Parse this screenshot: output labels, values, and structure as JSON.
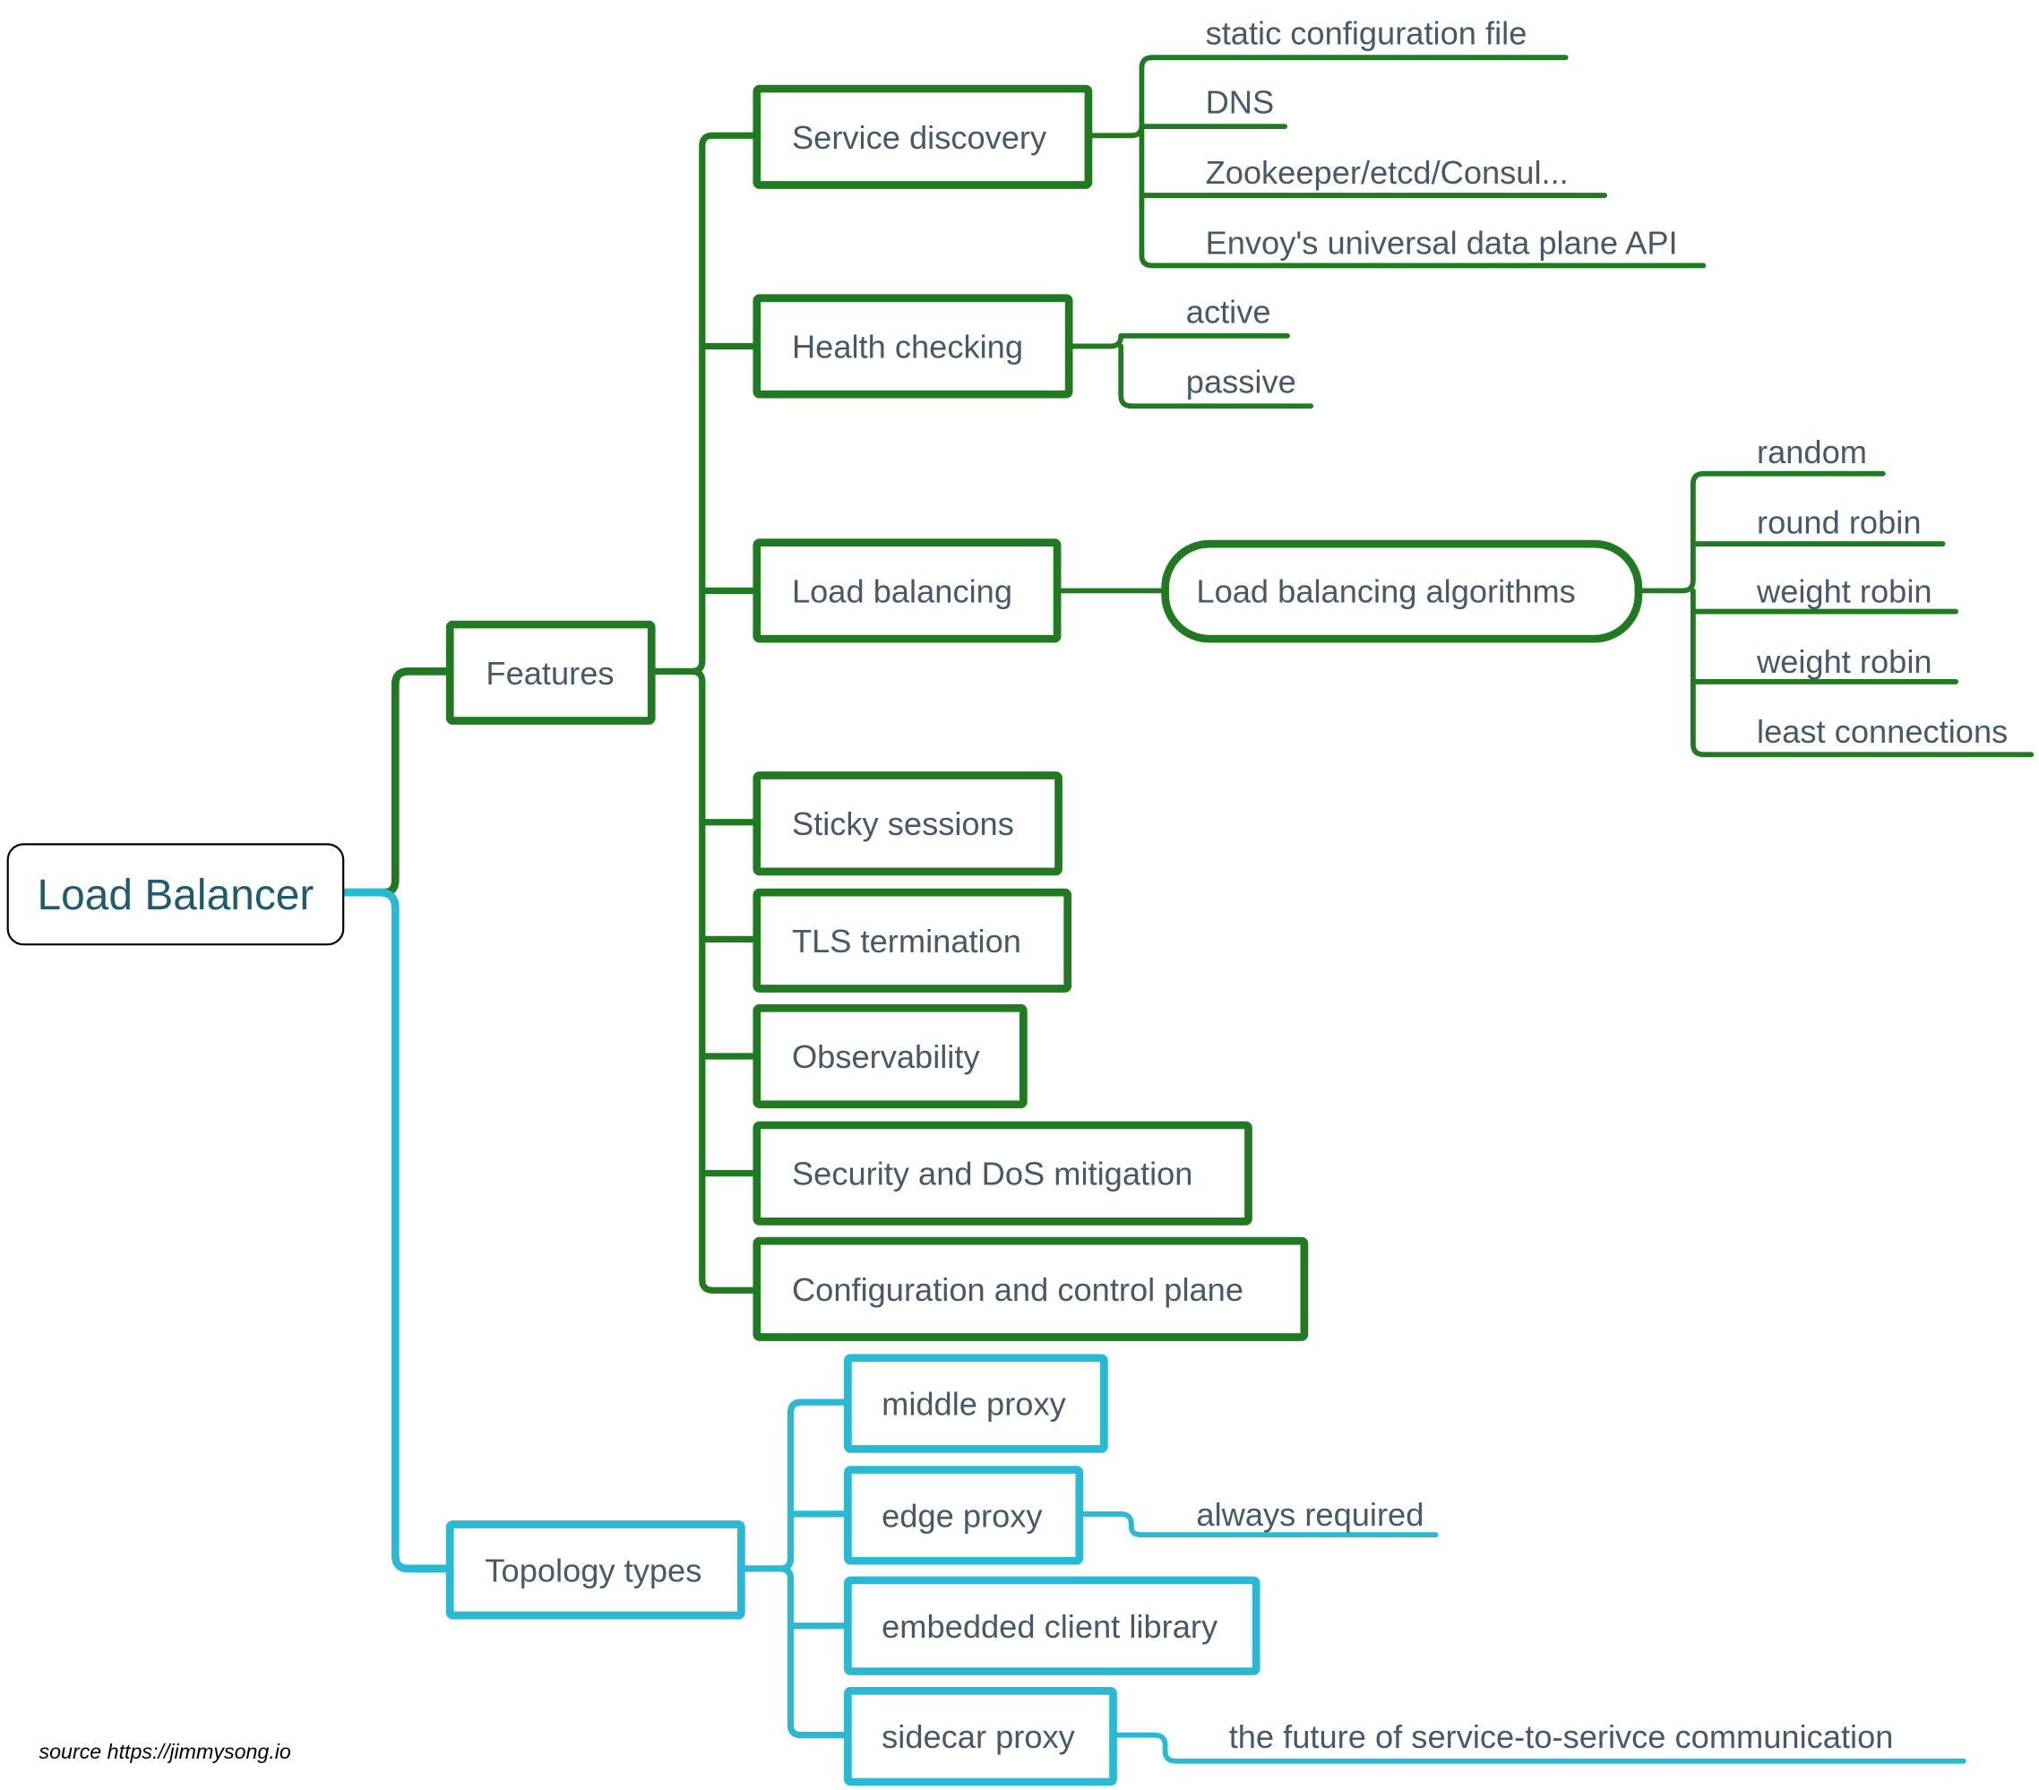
{
  "root": {
    "label": "Load Balancer"
  },
  "colors": {
    "features": "#217a21",
    "topology": "#29b9d2",
    "text": "#46586a",
    "root_text": "#1f5a6e"
  },
  "features": {
    "label": "Features",
    "children": [
      {
        "label": "Service discovery",
        "children": [
          "static configuration file",
          "DNS",
          "Zookeeper/etcd/Consul...",
          "Envoy's universal data plane API"
        ]
      },
      {
        "label": "Health checking",
        "children": [
          "active",
          "passive"
        ]
      },
      {
        "label": "Load balancing",
        "sub": {
          "label": "Load balancing algorithms",
          "children": [
            "random",
            "round robin",
            "weight robin",
            "weight robin",
            "least connections"
          ]
        }
      },
      {
        "label": "Sticky sessions"
      },
      {
        "label": "TLS termination"
      },
      {
        "label": "Observability"
      },
      {
        "label": "Security and DoS mitigation"
      },
      {
        "label": "Configuration and control plane"
      }
    ]
  },
  "topology": {
    "label": "Topology types",
    "children": [
      {
        "label": "middle proxy"
      },
      {
        "label": "edge proxy",
        "note": "always required"
      },
      {
        "label": "embedded client library"
      },
      {
        "label": "sidecar proxy",
        "note": "the future of service-to-serivce communication"
      }
    ]
  },
  "footer": {
    "source": "source https://jimmysong.io"
  }
}
